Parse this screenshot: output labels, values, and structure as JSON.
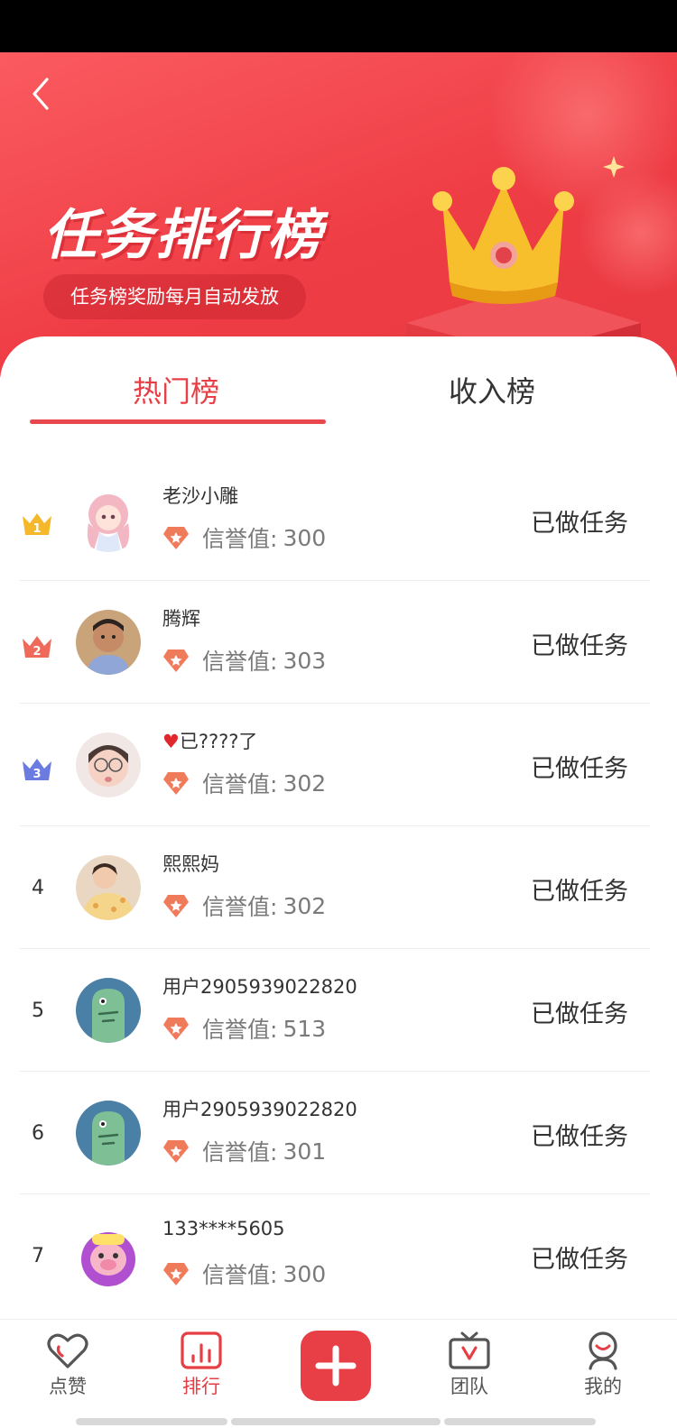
{
  "header": {
    "title": "任务排行榜",
    "subtitle": "任务榜奖励每月自动发放"
  },
  "tabs": [
    {
      "label": "热门榜",
      "active": true
    },
    {
      "label": "收入榜",
      "active": false
    }
  ],
  "credit_label": "信誉值:",
  "rows": [
    {
      "rank": "1",
      "name": "老沙小雕",
      "credit": "300",
      "status": "已做任务"
    },
    {
      "rank": "2",
      "name": "腾辉",
      "credit": "303",
      "status": "已做任务"
    },
    {
      "rank": "3",
      "name": "♥已????了",
      "credit": "302",
      "status": "已做任务"
    },
    {
      "rank": "4",
      "name": "熙熙妈",
      "credit": "302",
      "status": "已做任务"
    },
    {
      "rank": "5",
      "name": "用户2905939022820",
      "credit": "513",
      "status": "已做任务"
    },
    {
      "rank": "6",
      "name": "用户2905939022820",
      "credit": "301",
      "status": "已做任务"
    },
    {
      "rank": "7",
      "name": "133****5605",
      "credit": "300",
      "status": "已做任务"
    }
  ],
  "tabbar": [
    {
      "label": "点赞",
      "icon": "heart-icon"
    },
    {
      "label": "排行",
      "icon": "bar-chart-icon",
      "active": true
    },
    {
      "label": "",
      "icon": "plus-icon"
    },
    {
      "label": "团队",
      "icon": "tv-icon"
    },
    {
      "label": "我的",
      "icon": "user-icon"
    }
  ],
  "colors": {
    "accent": "#e83f46",
    "hero_start": "#fa5b60",
    "hero_end": "#e93a41",
    "badge_gold": "#f5b82a",
    "badge_red": "#ef6a5a",
    "badge_blue": "#6b7be0",
    "credit_icon": "#f07b5a"
  }
}
